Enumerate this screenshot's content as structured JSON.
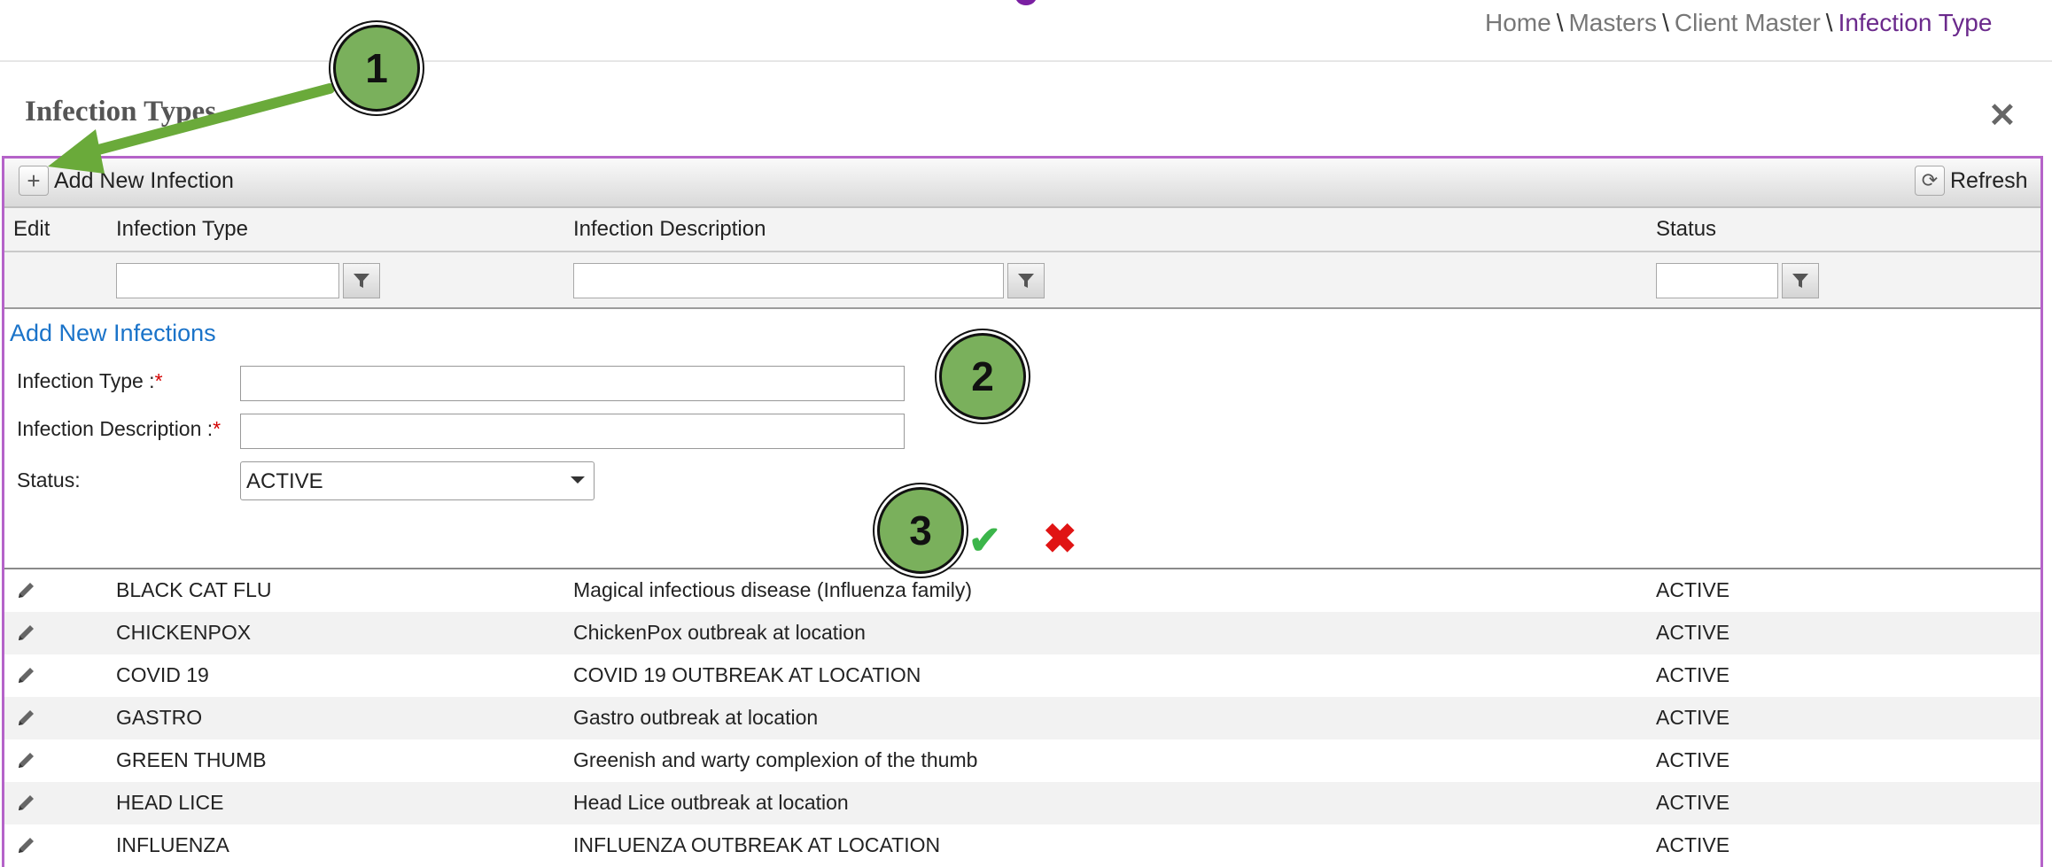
{
  "breadcrumb": {
    "items": [
      "Home",
      "Masters",
      "Client Master"
    ],
    "current": "Infection Type",
    "separator": "\\"
  },
  "page": {
    "title": "Infection Types"
  },
  "toolbar": {
    "add_label": "Add New Infection",
    "refresh_label": "Refresh"
  },
  "grid": {
    "columns": [
      "Edit",
      "Infection Type",
      "Infection Description",
      "Status"
    ]
  },
  "form": {
    "title": "Add New Infections",
    "type_label": "Infection Type :",
    "desc_label": "Infection Description :",
    "status_label": "Status:",
    "required_mark": "*",
    "status_value": "ACTIVE"
  },
  "rows": [
    {
      "type": "BLACK CAT FLU",
      "description": "Magical infectious disease (Influenza family)",
      "status": "ACTIVE"
    },
    {
      "type": "CHICKENPOX",
      "description": "ChickenPox outbreak at location",
      "status": "ACTIVE"
    },
    {
      "type": "COVID 19",
      "description": "COVID 19 OUTBREAK AT LOCATION",
      "status": "ACTIVE"
    },
    {
      "type": "GASTRO",
      "description": "Gastro outbreak at location",
      "status": "ACTIVE"
    },
    {
      "type": "GREEN THUMB",
      "description": "Greenish and warty complexion of the thumb",
      "status": "ACTIVE"
    },
    {
      "type": "HEAD LICE",
      "description": "Head Lice outbreak at location",
      "status": "ACTIVE"
    },
    {
      "type": "INFLUENZA",
      "description": "INFLUENZA OUTBREAK AT LOCATION",
      "status": "ACTIVE"
    }
  ],
  "callouts": [
    "1",
    "2",
    "3"
  ],
  "colors": {
    "callout": "#7ab05c",
    "arrow": "#6aaa3a",
    "accent": "#b563c9",
    "link": "#1a73c9"
  }
}
